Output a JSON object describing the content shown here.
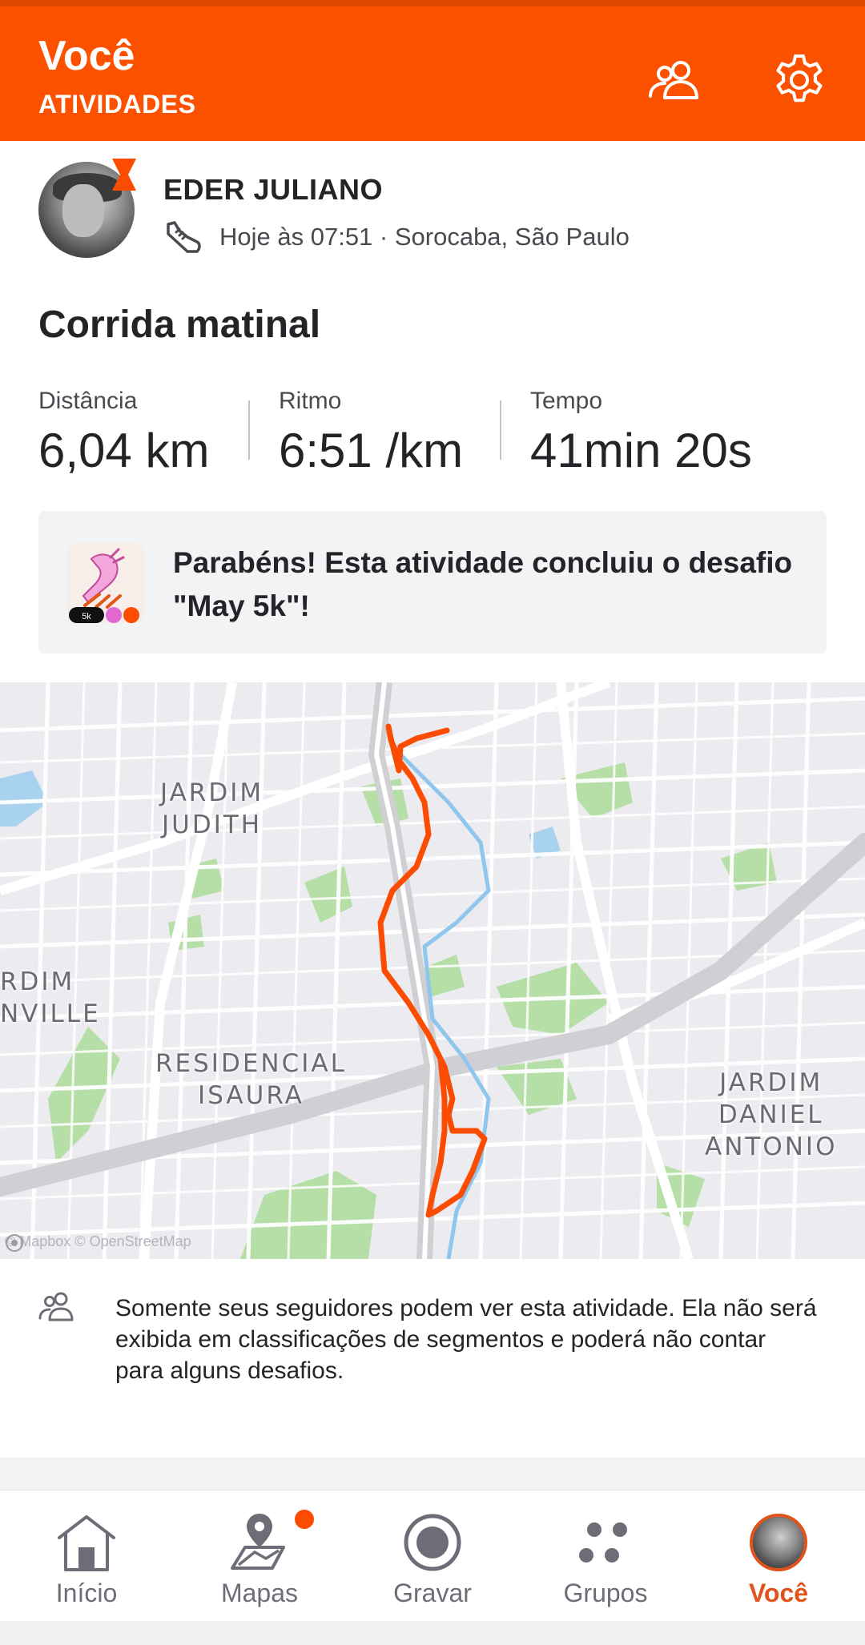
{
  "header": {
    "title": "Você",
    "subtitle": "ATIVIDADES",
    "people_icon": "people-icon",
    "settings_icon": "gear-icon",
    "background": "#FC5200"
  },
  "athlete": {
    "name": "EDER JULIANO",
    "meta": "Hoje às 07:51 · Sorocaba, São Paulo",
    "activity_icon": "running-shoe-icon"
  },
  "activity": {
    "title": "Corrida matinal",
    "stats": [
      {
        "label": "Distância",
        "value": "6,04 km"
      },
      {
        "label": "Ritmo",
        "value": "6:51 /km"
      },
      {
        "label": "Tempo",
        "value": "41min 20s"
      }
    ]
  },
  "challenge": {
    "text": "Parabéns! Esta atividade concluiu o desafio \"May 5k\"!",
    "badge_tag": "5k"
  },
  "map": {
    "labels": {
      "jardim_judith": "JARDIM\nJUDITH",
      "jardim_left": "RDIM\nNVILLE",
      "residencial": "RESIDENCIAL\nISAURA",
      "jardim_daniel": "JARDIM\nDANIEL\nANTONIO"
    },
    "attribution": "© Mapbox © OpenStreetMap",
    "route_color": "#FC4C02"
  },
  "privacy": {
    "text": "Somente seus seguidores podem ver esta atividade. Ela não será exibida em classificações de segmentos e poderá não contar para alguns desafios."
  },
  "nav": {
    "items": [
      {
        "label": "Início",
        "icon": "home-icon"
      },
      {
        "label": "Mapas",
        "icon": "map-icon"
      },
      {
        "label": "Gravar",
        "icon": "record-icon"
      },
      {
        "label": "Grupos",
        "icon": "groups-icon"
      },
      {
        "label": "Você",
        "icon": "avatar-icon"
      }
    ],
    "active_color": "#E0531C"
  }
}
